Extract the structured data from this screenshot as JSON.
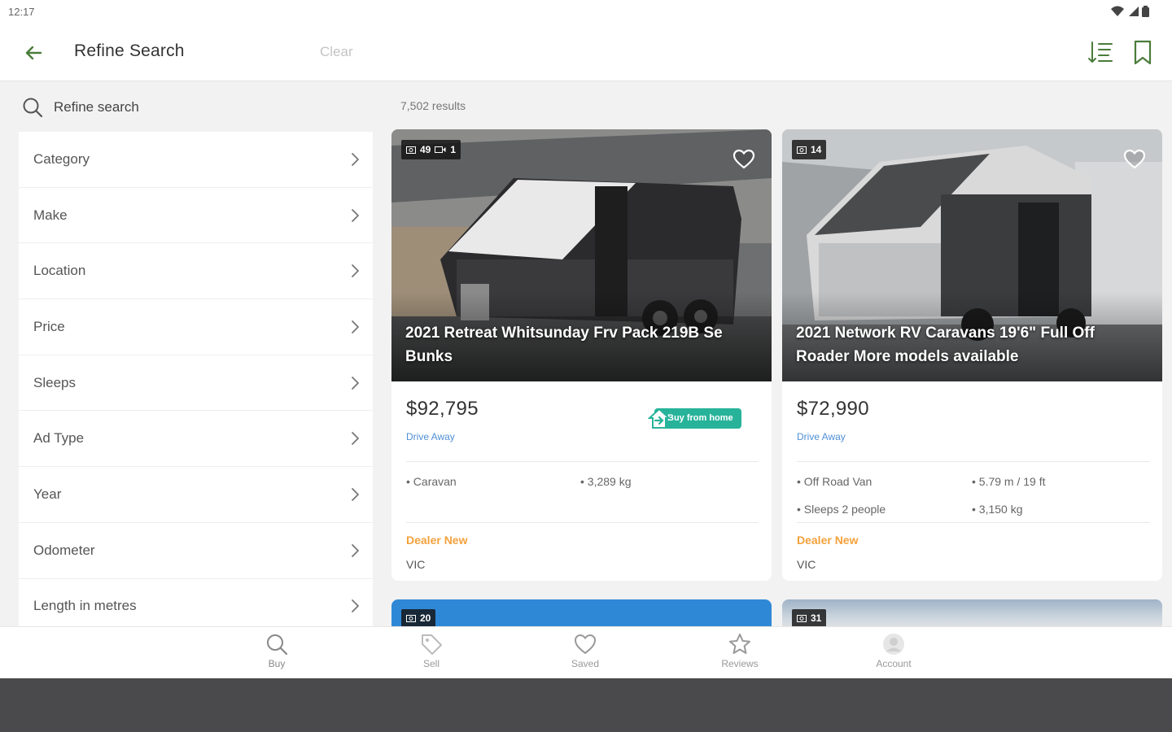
{
  "status_bar": {
    "time": "12:17"
  },
  "appbar": {
    "title": "Refine Search",
    "clear_label": "Clear"
  },
  "sidebar": {
    "search_label": "Refine search",
    "filters": [
      "Category",
      "Make",
      "Location",
      "Price",
      "Sleeps",
      "Ad Type",
      "Year",
      "Odometer",
      "Length in metres"
    ]
  },
  "results": {
    "count": "7,502 results",
    "listings": [
      {
        "photos": "49",
        "videos": "1",
        "title": "2021 Retreat Whitsunday Frv Pack 219B Se Bunks",
        "price": "$92,795",
        "price_note": "Drive Away",
        "badge": "Buy from home",
        "specs": [
          "• Caravan",
          "• 3,289 kg"
        ],
        "seller_type": "Dealer New",
        "state": "VIC"
      },
      {
        "photos": "14",
        "title": "2021 Network RV Caravans 19'6\" Full Off Roader More models available",
        "price": "$72,990",
        "price_note": "Drive Away",
        "specs": [
          "• Off Road Van",
          "• 5.79 m / 19 ft",
          "• Sleeps 2 people",
          "• 3,150 kg"
        ],
        "seller_type": "Dealer New",
        "state": "VIC"
      }
    ],
    "peek": [
      {
        "photos": "20"
      },
      {
        "photos": "31"
      }
    ]
  },
  "bottom_nav": [
    {
      "label": "Buy",
      "icon": "search-icon"
    },
    {
      "label": "Sell",
      "icon": "tag-icon"
    },
    {
      "label": "Saved",
      "icon": "heart-icon"
    },
    {
      "label": "Reviews",
      "icon": "star-icon"
    },
    {
      "label": "Account",
      "icon": "account-icon"
    }
  ],
  "colors": {
    "accent_blue": "#4f8fd6",
    "dealer_orange": "#f4a13c",
    "buy_from_home": "#27b39a"
  }
}
